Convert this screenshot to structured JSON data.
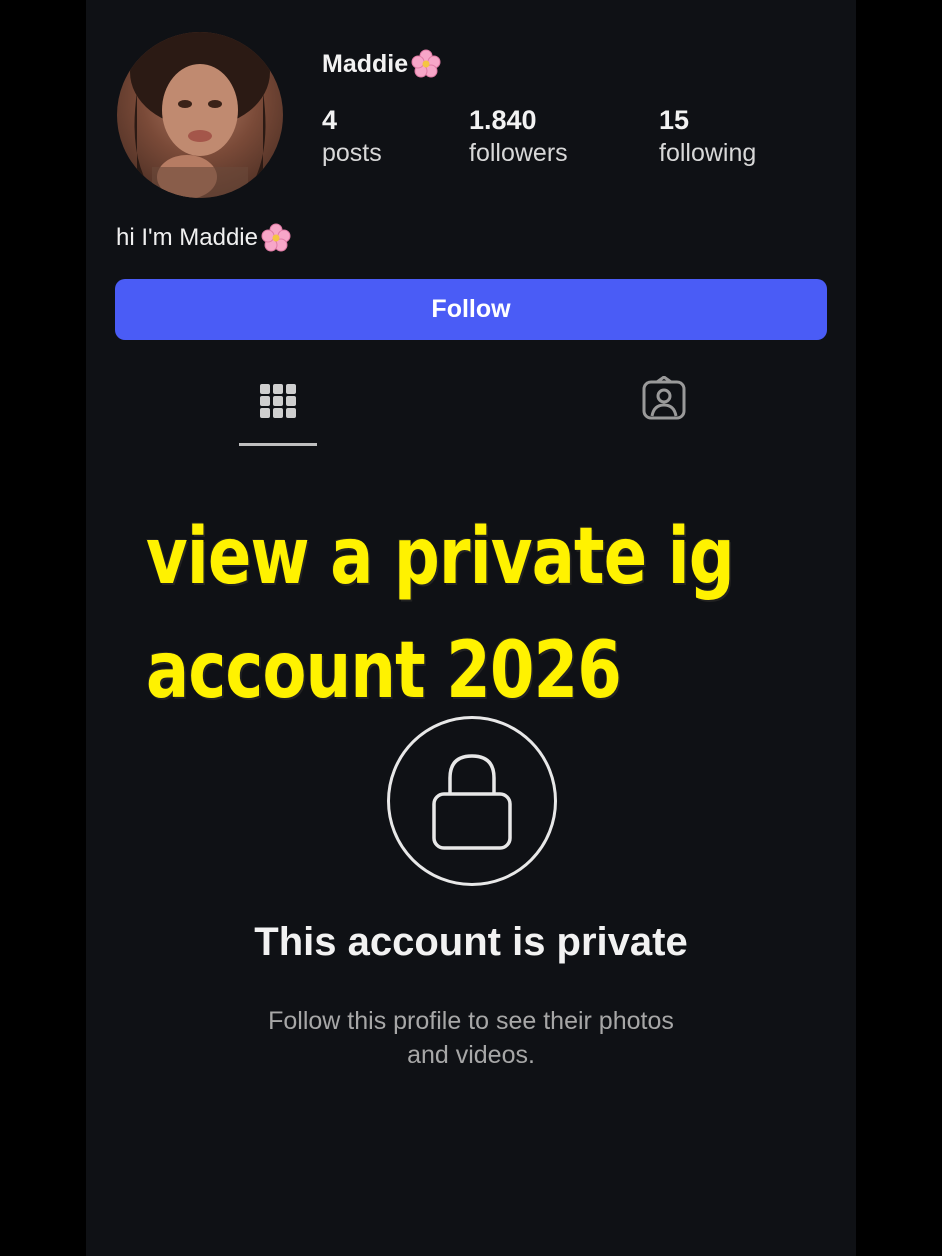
{
  "profile": {
    "username": "Maddie",
    "bio": "hi I'm Maddie",
    "stats": {
      "posts_count": "4",
      "posts_label": "posts",
      "followers_count": "1.840",
      "followers_label": "followers",
      "following_count": "15",
      "following_label": "following"
    }
  },
  "actions": {
    "follow_label": "Follow"
  },
  "tabs": {
    "grid_icon": "grid-icon",
    "tagged_icon": "tagged-person-icon"
  },
  "overlay": {
    "line1": "view a private ig",
    "line2": "account 2026"
  },
  "private_notice": {
    "icon": "lock-icon",
    "title": "This account is private",
    "subtitle_line1": "Follow this profile to see their photos",
    "subtitle_line2": "and videos."
  },
  "colors": {
    "background": "#0f1115",
    "follow_button": "#4a5cf6",
    "overlay_text": "#fff200"
  }
}
